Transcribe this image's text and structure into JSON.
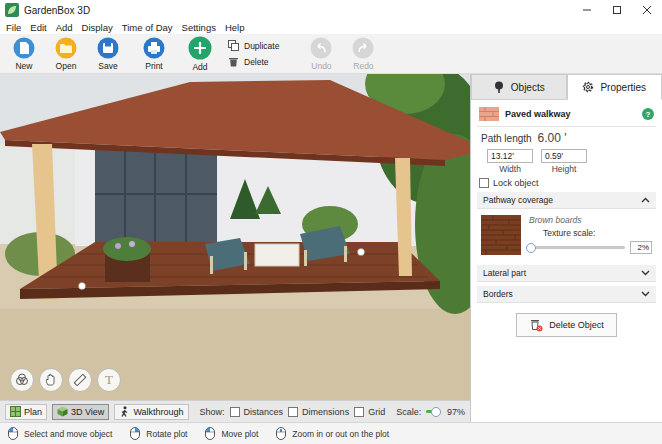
{
  "window": {
    "title": "GardenBox 3D"
  },
  "menu": [
    "File",
    "Edit",
    "Add",
    "Display",
    "Time of Day",
    "Settings",
    "Help"
  ],
  "toolbar": {
    "groups": [
      {
        "kind": "large",
        "items": [
          {
            "label": "New",
            "disabled": false
          },
          {
            "label": "Open",
            "disabled": false
          },
          {
            "label": "Save",
            "disabled": false
          }
        ]
      },
      {
        "kind": "large",
        "items": [
          {
            "label": "Print",
            "disabled": false
          }
        ]
      },
      {
        "kind": "large",
        "items": [
          {
            "label": "Add",
            "disabled": false
          }
        ]
      },
      {
        "kind": "small",
        "items": [
          {
            "label": "Duplicate",
            "disabled": false
          },
          {
            "label": "Delete",
            "disabled": false
          }
        ]
      },
      {
        "kind": "large",
        "items": [
          {
            "label": "Undo",
            "disabled": true
          },
          {
            "label": "Redo",
            "disabled": true
          }
        ]
      }
    ]
  },
  "view_tools": {
    "text_tool": {
      "label": "T",
      "disabled": true
    }
  },
  "panel": {
    "tabs": [
      {
        "label": "Objects",
        "selected": false
      },
      {
        "label": "Properties",
        "selected": true
      }
    ],
    "object": {
      "name": "Paved walkway",
      "help": "?"
    },
    "path_length": {
      "label": "Path length",
      "value": "6.00 '"
    },
    "fields": [
      {
        "value": "13.12'",
        "label": "Width"
      },
      {
        "value": "0.59'",
        "label": "Height"
      }
    ],
    "lock": {
      "label": "Lock object",
      "checked": false
    },
    "sections": [
      {
        "title": "Pathway coverage",
        "expanded": true
      },
      {
        "title": "Lateral part",
        "expanded": false
      },
      {
        "title": "Borders",
        "expanded": false
      }
    ],
    "coverage": {
      "texture": "Brown boards",
      "scale_label": "Texture scale:",
      "level": 0.02,
      "value": "2%"
    },
    "delete_button": "Delete Object"
  },
  "view_bar": {
    "modes": [
      {
        "label": "Plan",
        "selected": false
      },
      {
        "label": "3D View",
        "selected": true
      },
      {
        "label": "Walkthrough",
        "selected": false
      }
    ],
    "show_label": "Show:",
    "show": [
      {
        "label": "Distances",
        "checked": false
      },
      {
        "label": "Dimensions",
        "checked": false
      },
      {
        "label": "Grid",
        "checked": false
      }
    ],
    "scale": {
      "label": "Scale:",
      "level": 0.97,
      "value": "97%"
    }
  },
  "status_bar": [
    "Select and move object",
    "Rotate plot",
    "Move plot",
    "Zoom in or out on the plot"
  ]
}
